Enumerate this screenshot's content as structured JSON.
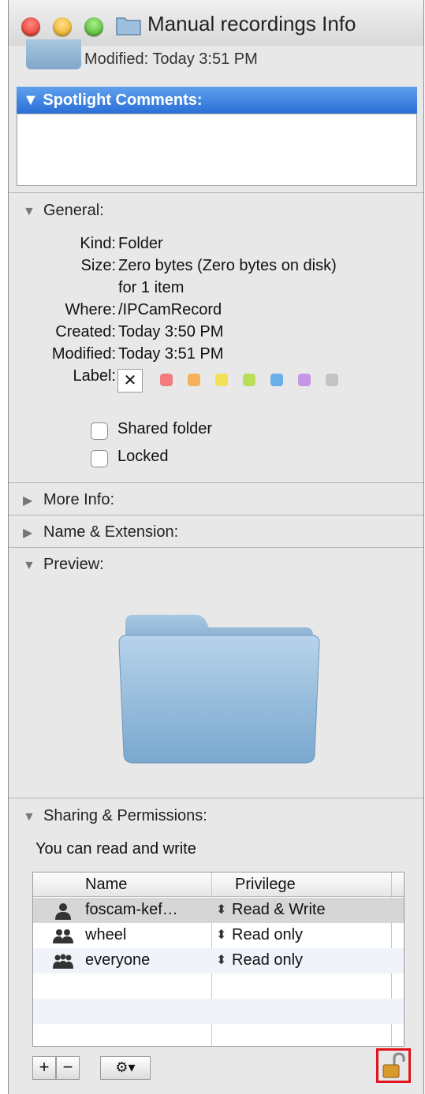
{
  "window": {
    "title": "Manual recordings Info"
  },
  "header": {
    "modified": "Modified: Today 3:51 PM"
  },
  "spotlight": {
    "label": "▼ Spotlight Comments:"
  },
  "general": {
    "heading": "General:",
    "rows": [
      {
        "label": "Kind:",
        "value": "Folder"
      },
      {
        "label": "Size:",
        "value": "Zero bytes (Zero bytes on disk)"
      },
      {
        "label": "",
        "value": "for 1 item"
      },
      {
        "label": "Where:",
        "value": "/IPCamRecord"
      },
      {
        "label": "Created:",
        "value": "Today 3:50 PM"
      },
      {
        "label": "Modified:",
        "value": "Today 3:51 PM"
      }
    ],
    "label_field": "Label:",
    "label_clear": "✕",
    "label_colors": [
      "#f47b7b",
      "#f5b25b",
      "#f2e05a",
      "#b9df5a",
      "#6aaeea",
      "#c596e6",
      "#c4c4c4"
    ],
    "shared_folder": "Shared folder",
    "locked": "Locked"
  },
  "sections": {
    "more_info": "More Info:",
    "name_ext": "Name & Extension:",
    "preview": "Preview:",
    "sharing": "Sharing & Permissions:"
  },
  "permissions": {
    "note": "You can read and write",
    "col_name": "Name",
    "col_privilege": "Privilege",
    "rows": [
      {
        "name": "foscam-kef…",
        "privilege": "Read & Write",
        "icon": "user-icon"
      },
      {
        "name": "wheel",
        "privilege": "Read only",
        "icon": "group-icon"
      },
      {
        "name": "everyone",
        "privilege": "Read only",
        "icon": "everyone-icon"
      }
    ]
  },
  "buttons": {
    "add": "+",
    "remove": "−",
    "action": "⚙▾"
  }
}
